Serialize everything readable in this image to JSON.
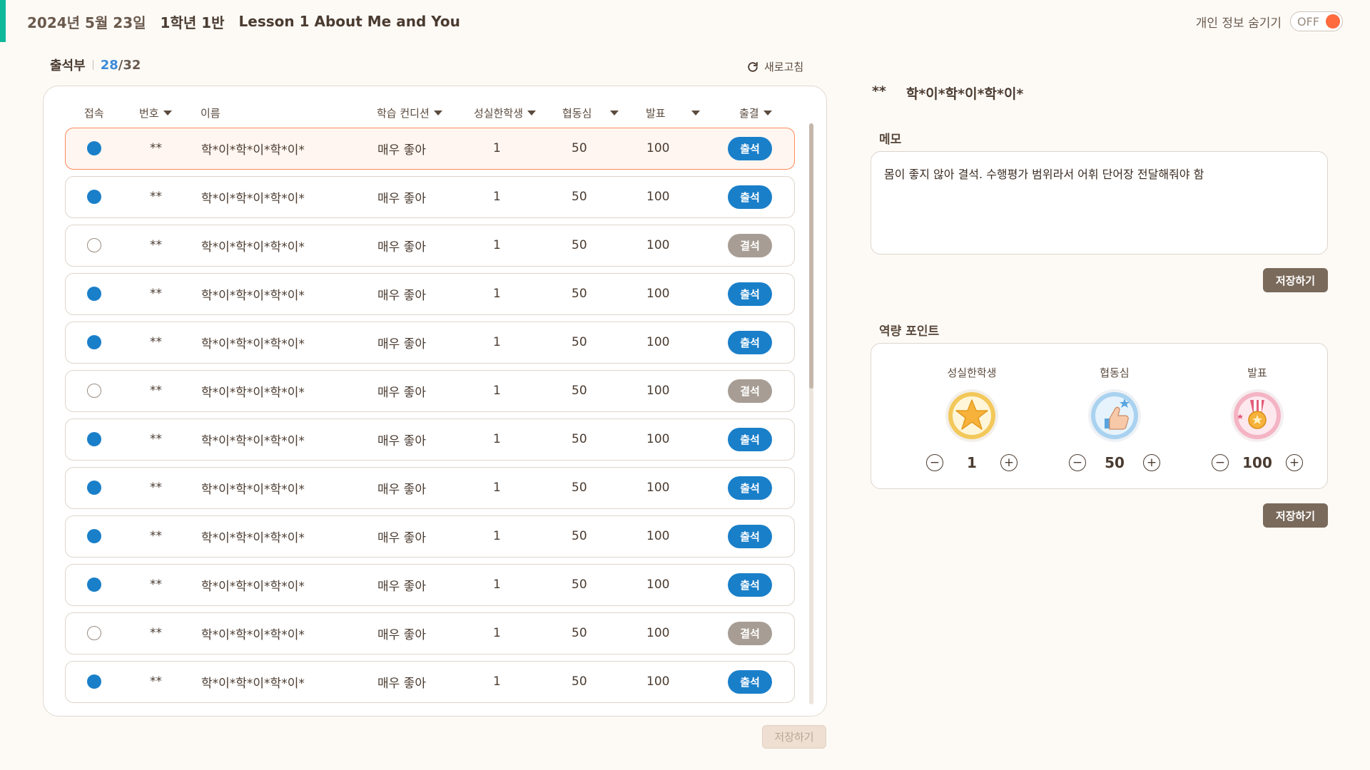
{
  "header": {
    "date": "2024년 5월 23일",
    "class_name": "1학년 1반",
    "lesson": "Lesson 1 About Me and You",
    "privacy_label": "개인 정보 숨기기",
    "toggle_state": "OFF"
  },
  "attendance": {
    "title": "출석부",
    "present_count": "28",
    "total": "/32",
    "refresh_label": "새로고침",
    "columns": [
      "접속",
      "번호",
      "이름",
      "학습 컨디션",
      "성실한학생",
      "협동심",
      "발표",
      "출결"
    ],
    "rows": [
      {
        "connected": true,
        "number": "**",
        "name": "학*이*학*이*학*이*",
        "condition": "매우 좋아",
        "diligent": "1",
        "teamwork": "50",
        "presentation": "100",
        "status": "출석",
        "selected": true
      },
      {
        "connected": true,
        "number": "**",
        "name": "학*이*학*이*학*이*",
        "condition": "매우 좋아",
        "diligent": "1",
        "teamwork": "50",
        "presentation": "100",
        "status": "출석"
      },
      {
        "connected": false,
        "number": "**",
        "name": "학*이*학*이*학*이*",
        "condition": "매우 좋아",
        "diligent": "1",
        "teamwork": "50",
        "presentation": "100",
        "status": "결석"
      },
      {
        "connected": true,
        "number": "**",
        "name": "학*이*학*이*학*이*",
        "condition": "매우 좋아",
        "diligent": "1",
        "teamwork": "50",
        "presentation": "100",
        "status": "출석"
      },
      {
        "connected": true,
        "number": "**",
        "name": "학*이*학*이*학*이*",
        "condition": "매우 좋아",
        "diligent": "1",
        "teamwork": "50",
        "presentation": "100",
        "status": "출석"
      },
      {
        "connected": false,
        "number": "**",
        "name": "학*이*학*이*학*이*",
        "condition": "매우 좋아",
        "diligent": "1",
        "teamwork": "50",
        "presentation": "100",
        "status": "결석"
      },
      {
        "connected": true,
        "number": "**",
        "name": "학*이*학*이*학*이*",
        "condition": "매우 좋아",
        "diligent": "1",
        "teamwork": "50",
        "presentation": "100",
        "status": "출석"
      },
      {
        "connected": true,
        "number": "**",
        "name": "학*이*학*이*학*이*",
        "condition": "매우 좋아",
        "diligent": "1",
        "teamwork": "50",
        "presentation": "100",
        "status": "출석"
      },
      {
        "connected": true,
        "number": "**",
        "name": "학*이*학*이*학*이*",
        "condition": "매우 좋아",
        "diligent": "1",
        "teamwork": "50",
        "presentation": "100",
        "status": "출석"
      },
      {
        "connected": true,
        "number": "**",
        "name": "학*이*학*이*학*이*",
        "condition": "매우 좋아",
        "diligent": "1",
        "teamwork": "50",
        "presentation": "100",
        "status": "출석"
      },
      {
        "connected": false,
        "number": "**",
        "name": "학*이*학*이*학*이*",
        "condition": "매우 좋아",
        "diligent": "1",
        "teamwork": "50",
        "presentation": "100",
        "status": "결석"
      },
      {
        "connected": true,
        "number": "**",
        "name": "학*이*학*이*학*이*",
        "condition": "매우 좋아",
        "diligent": "1",
        "teamwork": "50",
        "presentation": "100",
        "status": "출석"
      }
    ],
    "save_label": "저장하기"
  },
  "detail": {
    "number": "**",
    "name": "학*이*학*이*학*이*",
    "memo_label": "메모",
    "memo_text": "몸이 좋지 않아 결석. 수행평가 범위라서 어휘 단어장 전달해줘야 함",
    "memo_save_label": "저장하기",
    "competency_label": "역량 포인트",
    "competencies": [
      {
        "name": "성실한학생",
        "value": "1",
        "icon": "star-medal-icon"
      },
      {
        "name": "협동심",
        "value": "50",
        "icon": "thumbs-up-medal-icon"
      },
      {
        "name": "발표",
        "value": "100",
        "icon": "ribbon-medal-icon"
      }
    ],
    "competency_save_label": "저장하기"
  },
  "colors": {
    "accent": "#10b89a",
    "present": "#1a7fc9",
    "absent": "#a79d94",
    "selected_border": "#ff8a5c",
    "toggle_knob": "#ff6b3d",
    "save_button": "#7a6a5b"
  }
}
